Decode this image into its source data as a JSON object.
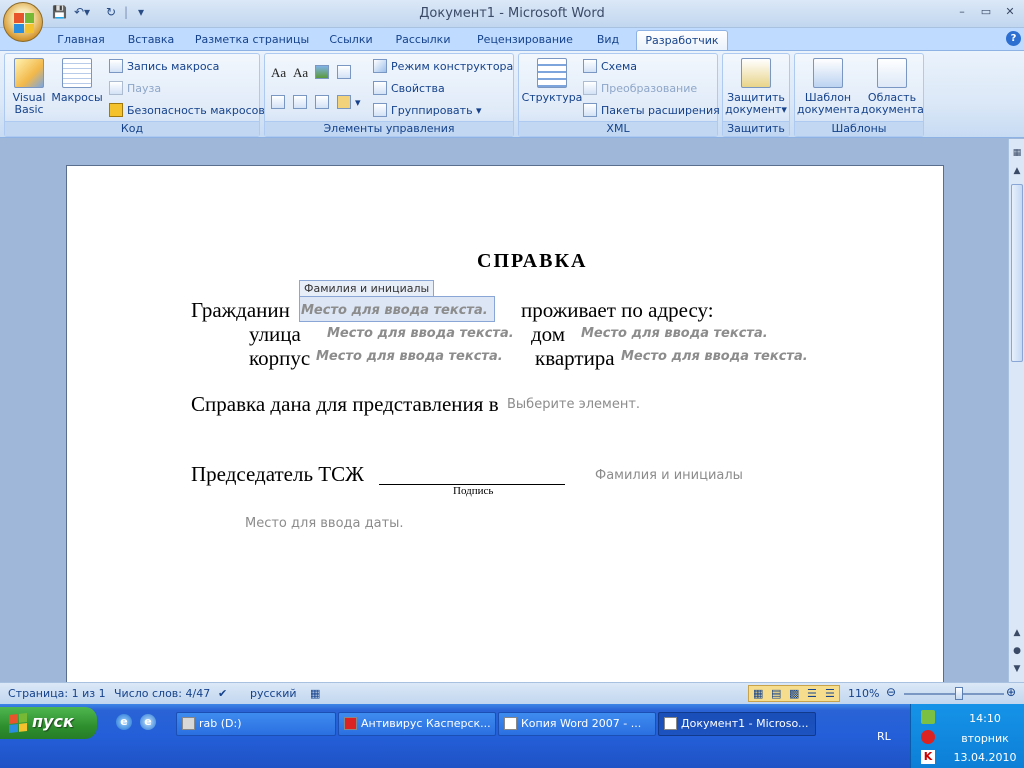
{
  "window": {
    "title": "Документ1 - Microsoft Word",
    "controls": [
      "–",
      "▭",
      "✕"
    ]
  },
  "quick_access": {
    "save_icon": "save-icon",
    "undo_icon": "undo-icon",
    "redo_icon": "redo-icon"
  },
  "tabs": [
    "Главная",
    "Вставка",
    "Разметка страницы",
    "Ссылки",
    "Рассылки",
    "Рецензирование",
    "Вид",
    "Разработчик"
  ],
  "help_icon": "help-icon",
  "ribbon": {
    "code": {
      "label": "Код",
      "visual_basic": "Visual Basic",
      "macros": "Макросы",
      "record": "Запись макроса",
      "pause": "Пауза",
      "security": "Безопасность макросов"
    },
    "controls": {
      "label": "Элементы управления",
      "design_mode": "Режим конструктора",
      "properties": "Свойства",
      "group": "Группировать"
    },
    "xml": {
      "label": "XML",
      "structure": "Структура",
      "schema": "Схема",
      "transform": "Преобразование",
      "packs": "Пакеты расширения"
    },
    "protect": {
      "label": "Защитить",
      "protect_doc": "Защитить документ"
    },
    "templates": {
      "label": "Шаблоны",
      "doc_template": "Шаблон документа",
      "doc_area": "Область документа"
    }
  },
  "document": {
    "title": "СПРАВКА",
    "citizen_label": "Гражданин",
    "cc_tag": "Фамилия и инициалы",
    "placeholder": "Место для ввода текста.",
    "lives_at": "проживает по адресу:",
    "street": "улица",
    "house": "дом",
    "building": "корпус",
    "apartment": "квартира",
    "issued_for": "Справка дана для представления в",
    "choose_item": "Выберите элемент.",
    "chairman": "Председатель ТСЖ",
    "signature": "Подпись",
    "name_placeholder": "Фамилия и инициалы",
    "date_placeholder": "Место для ввода даты."
  },
  "status": {
    "page": "Страница: 1 из 1",
    "words": "Число слов: 4/47",
    "lang": "русский",
    "zoom": "110%",
    "zoom_fraction": 0.55
  },
  "taskbar": {
    "start": "пуск",
    "tasks": [
      "rab (D:)",
      "Антивирус Касперск...",
      "Копия Word 2007 - ...",
      "Документ1 - Microso..."
    ],
    "lang": "RL",
    "time": "14:10",
    "day": "вторник",
    "date": "13.04.2010"
  }
}
